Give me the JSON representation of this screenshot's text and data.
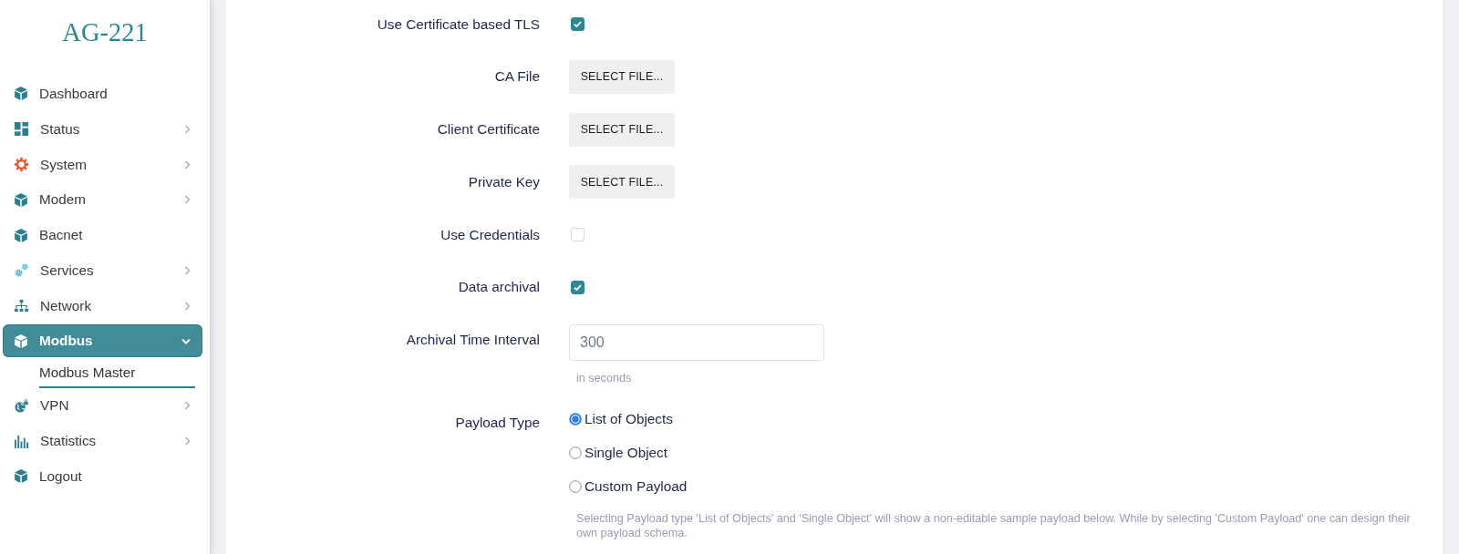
{
  "sidebar": {
    "logo": "AG-221",
    "items": [
      {
        "label": "Dashboard",
        "kind": "link",
        "selected": false
      },
      {
        "label": "Status",
        "kind": "group",
        "selected": false,
        "expanded": false
      },
      {
        "label": "System",
        "kind": "group",
        "selected": false,
        "expanded": false
      },
      {
        "label": "Modem",
        "kind": "group",
        "selected": false,
        "expanded": false
      },
      {
        "label": "Bacnet",
        "kind": "link",
        "selected": false
      },
      {
        "label": "Services",
        "kind": "group",
        "selected": false,
        "expanded": false
      },
      {
        "label": "Network",
        "kind": "group",
        "selected": false,
        "expanded": false
      },
      {
        "label": "Modbus",
        "kind": "group",
        "selected": true,
        "expanded": true,
        "children": [
          {
            "label": "Modbus Master",
            "selected": true
          }
        ]
      },
      {
        "label": "VPN",
        "kind": "group",
        "selected": false,
        "expanded": false
      },
      {
        "label": "Statistics",
        "kind": "group",
        "selected": false,
        "expanded": false
      },
      {
        "label": "Logout",
        "kind": "link",
        "selected": false
      }
    ]
  },
  "form": {
    "rows": [
      {
        "kind": "checkbox",
        "label": "Use Certificate based TLS",
        "checked": true
      },
      {
        "kind": "file",
        "label": "CA File",
        "button": "SELECT FILE..."
      },
      {
        "kind": "file",
        "label": "Client Certificate",
        "button": "SELECT FILE..."
      },
      {
        "kind": "file",
        "label": "Private Key",
        "button": "SELECT FILE..."
      },
      {
        "kind": "checkbox",
        "label": "Use Credentials",
        "checked": false
      },
      {
        "kind": "checkbox",
        "label": "Data archival",
        "checked": true
      },
      {
        "kind": "input",
        "label": "Archival Time Interval",
        "value": "300",
        "hint": "in seconds"
      },
      {
        "kind": "radio",
        "label": "Payload Type",
        "options": [
          {
            "label": "List of Objects",
            "selected": true
          },
          {
            "label": "Single Object",
            "selected": false
          },
          {
            "label": "Custom Payload",
            "selected": false
          }
        ],
        "hint": "Selecting Payload type 'List of Objects' and 'Single Object' will show a non-editable sample payload below. While by selecting 'Custom Payload' one can design their own payload schema."
      }
    ]
  }
}
